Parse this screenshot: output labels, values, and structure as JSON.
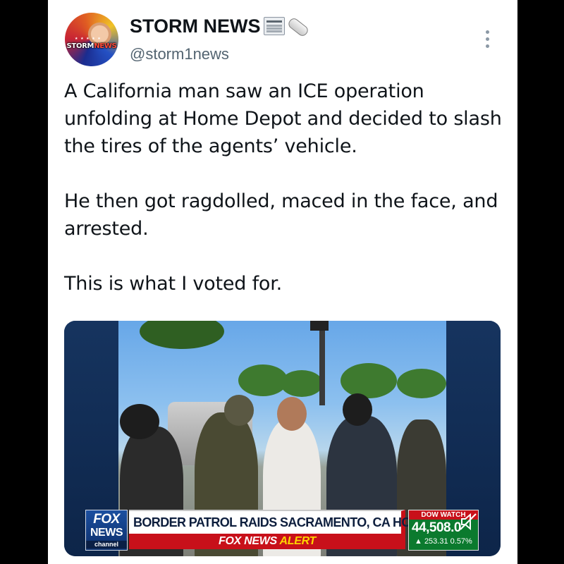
{
  "account": {
    "display_name": "STORM NEWS",
    "name_emoji": [
      "newspaper-icon",
      "scroll-icon"
    ],
    "handle": "@storm1news",
    "avatar_logo_text": "STORM",
    "avatar_logo_accent": "NEWS",
    "avatar_stars": "★ ★ ★ ★ ★"
  },
  "tweet": {
    "paragraphs": [
      "A California man saw an ICE operation unfolding at Home Depot and decided to slash the tires of the agents’ vehicle.",
      "He then got ragdolled, maced in the face, and arrested.",
      "This is what I voted for."
    ]
  },
  "media": {
    "chyron": {
      "logo_fox": "FOX",
      "logo_news": "NEWS",
      "logo_channel": "channel",
      "headline": "BORDER PATROL RAIDS SACRAMENTO, CA HOME DEPOT",
      "alert_prefix": "FOX NEWS",
      "alert_word": "ALERT",
      "dow_label": "DOW WATCH",
      "dow_value": "44,508.0",
      "dow_change": "▲ 253.31 0.57%"
    },
    "mute_icon": "mute-icon"
  },
  "colors": {
    "text": "#0f1419",
    "secondary": "#536471",
    "fox_red": "#c8101a",
    "fox_blue": "#0d2f6a",
    "dow_green": "#0b7a2e",
    "alert_yellow": "#ffd400"
  }
}
